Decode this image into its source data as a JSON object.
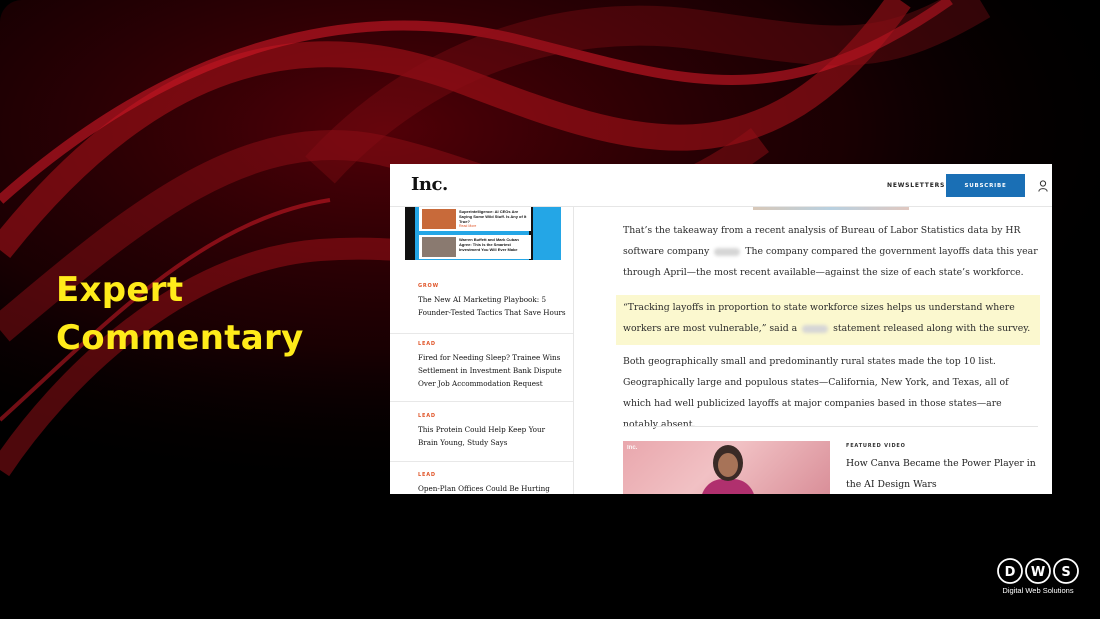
{
  "headline": {
    "line1": "Expert",
    "line2": "Commentary"
  },
  "site": {
    "logo": "Inc.",
    "newsletters_label": "NEWSLETTERS",
    "subscribe_label": "SUBSCRIBE"
  },
  "promo": {
    "item1": "Superintelligence: AI CEOs Are Saying Some Wild Stuff. Is Any of It True?",
    "item1_readmore": "Read More",
    "item2": "Warren Buffett and Mark Cuban Agree: This Is the Smartest Investment You Will Ever Make"
  },
  "sidebar": {
    "items": [
      {
        "tag": "GROW",
        "title": "The New AI Marketing Playbook: 5 Founder-Tested Tactics That Save Hours"
      },
      {
        "tag": "LEAD",
        "title": "Fired for Needing Sleep? Trainee Wins Settlement in Investment Bank Dispute Over Job Accommodation Request"
      },
      {
        "tag": "LEAD",
        "title": "This Protein Could Help Keep Your Brain Young, Study Says"
      },
      {
        "tag": "LEAD",
        "title": "Open-Plan Offices Could Be Hurting"
      }
    ]
  },
  "article": {
    "p1a": "That’s the takeaway from a recent analysis of Bureau of Labor Statistics data by HR software company",
    "p1b": "The company compared the government layoffs data this year through April—the most recent available—against the size of each state’s workforce.",
    "quote_a": "“Tracking layoffs in proportion to state workforce sizes helps us understand where workers are most vulnerable,” said a",
    "quote_b": "statement released along with the survey.",
    "p3": "Both geographically small and predominantly rural states made the top 10 list. Geographically large and populous states—California, New York, and Texas, all of which had well publicized layoffs at major companies based in those states—are notably absent."
  },
  "featured_video": {
    "tag": "FEATURED VIDEO",
    "title": "How Canva Became the Power Player in the AI Design Wars",
    "thumb_logo": "Inc."
  },
  "brand": {
    "logo": "DWS",
    "tagline": "Digital Web Solutions"
  },
  "colors": {
    "headline": "#ffeb1a",
    "accent": "#e0562a",
    "subscribe": "#1a6fb5",
    "quote_highlight": "#fbf8cf"
  },
  "icons": [
    "user-icon",
    "dws-logo"
  ]
}
